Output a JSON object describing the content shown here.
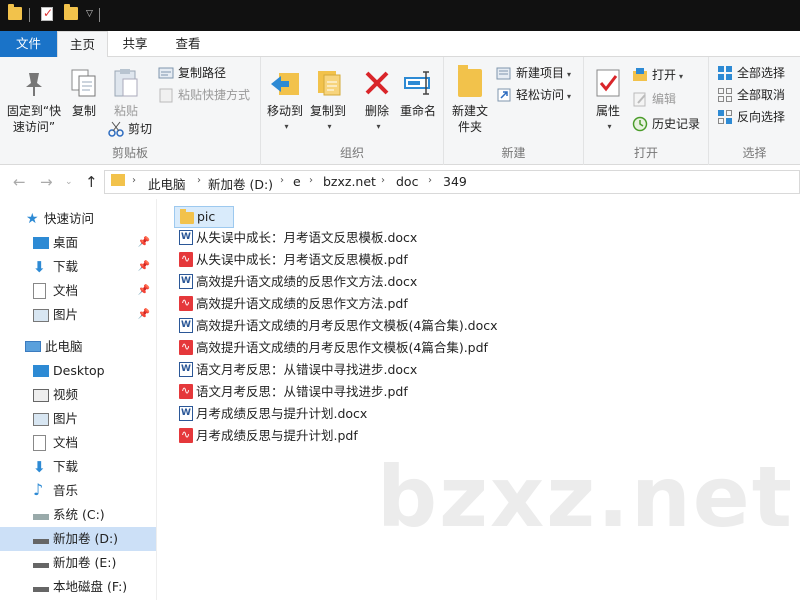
{
  "quick_access_toolbar": {
    "icons": [
      "folder-icon",
      "properties-icon",
      "new-folder-icon",
      "dropdown-icon"
    ]
  },
  "tabs": {
    "file": "文件",
    "home": "主页",
    "share": "共享",
    "view": "查看"
  },
  "ribbon": {
    "clipboard": {
      "label": "剪贴板",
      "pin": "固定到“快速访问”",
      "copy": "复制",
      "paste": "粘贴",
      "copy_path": "复制路径",
      "paste_shortcut": "粘贴快捷方式",
      "cut": "剪切"
    },
    "organize": {
      "label": "组织",
      "move_to": "移动到",
      "copy_to": "复制到",
      "delete": "删除",
      "rename": "重命名"
    },
    "new": {
      "label": "新建",
      "new_folder": "新建文件夹",
      "new_item": "新建项目",
      "easy_access": "轻松访问"
    },
    "open": {
      "label": "打开",
      "properties": "属性",
      "open": "打开",
      "edit": "编辑",
      "history": "历史记录"
    },
    "select": {
      "label": "选择",
      "select_all": "全部选择",
      "select_none": "全部取消",
      "invert": "反向选择"
    }
  },
  "address": {
    "crumbs": [
      "此电脑",
      "新加卷 (D:)",
      "e",
      "bzxz.net",
      "doc",
      "349"
    ]
  },
  "nav": {
    "quick_access": "快速访问",
    "qa_items": [
      "桌面",
      "下载",
      "文档",
      "图片"
    ],
    "this_pc": "此电脑",
    "pc_items": [
      "Desktop",
      "视频",
      "图片",
      "文档",
      "下载",
      "音乐",
      "系统 (C:)",
      "新加卷 (D:)",
      "新加卷 (E:)",
      "本地磁盘 (F:)"
    ]
  },
  "files": [
    {
      "name": "pic",
      "type": "folder"
    },
    {
      "name": "从失误中成长：月考语文反思模板.docx",
      "type": "docx"
    },
    {
      "name": "从失误中成长：月考语文反思模板.pdf",
      "type": "pdf"
    },
    {
      "name": "高效提升语文成绩的反思作文方法.docx",
      "type": "docx"
    },
    {
      "name": "高效提升语文成绩的反思作文方法.pdf",
      "type": "pdf"
    },
    {
      "name": "高效提升语文成绩的月考反思作文模板(4篇合集).docx",
      "type": "docx"
    },
    {
      "name": "高效提升语文成绩的月考反思作文模板(4篇合集).pdf",
      "type": "pdf"
    },
    {
      "name": "语文月考反思：从错误中寻找进步.docx",
      "type": "docx"
    },
    {
      "name": "语文月考反思：从错误中寻找进步.pdf",
      "type": "pdf"
    },
    {
      "name": "月考成绩反思与提升计划.docx",
      "type": "docx"
    },
    {
      "name": "月考成绩反思与提升计划.pdf",
      "type": "pdf"
    }
  ],
  "watermark": "bzxz.net",
  "colors": {
    "accent": "#1a73c8",
    "selection": "#cce0f7",
    "folder": "#f2c24b",
    "pdf": "#e5383b",
    "word": "#2b5797"
  }
}
